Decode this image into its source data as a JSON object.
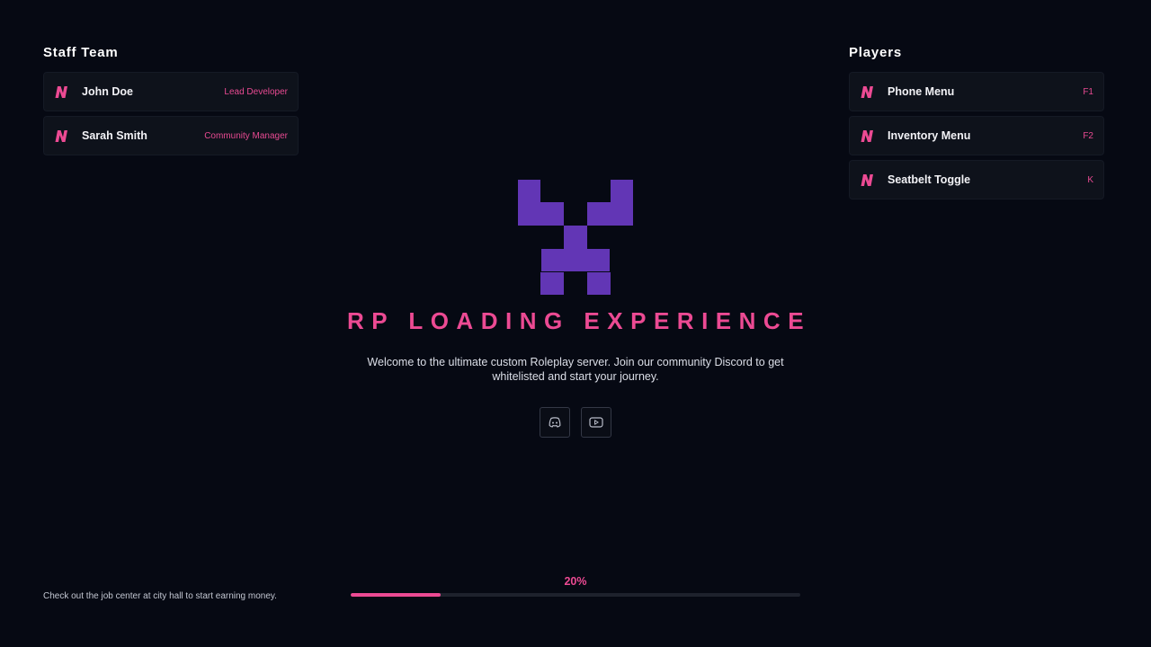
{
  "staff": {
    "title": "Staff Team",
    "members": [
      {
        "name": "John Doe",
        "role": "Lead Developer"
      },
      {
        "name": "Sarah Smith",
        "role": "Community Manager"
      }
    ]
  },
  "players": {
    "title": "Players",
    "keybinds": [
      {
        "label": "Phone Menu",
        "key": "F1"
      },
      {
        "label": "Inventory Menu",
        "key": "F2"
      },
      {
        "label": "Seatbelt Toggle",
        "key": "K"
      }
    ]
  },
  "hero": {
    "title": "RP LOADING EXPERIENCE",
    "description": "Welcome to the ultimate custom Roleplay server. Join our community Discord to get whitelisted and start your journey."
  },
  "social": [
    {
      "icon": "discord-icon"
    },
    {
      "icon": "youtube-icon"
    }
  ],
  "tip": "Check out the job center at city hall to start earning money.",
  "progress": {
    "label": "20%",
    "value": 0.2
  },
  "colors": {
    "background": "#060913",
    "accent": "#ec4a93",
    "logo": "#6236b5",
    "card": "#0e121b"
  }
}
